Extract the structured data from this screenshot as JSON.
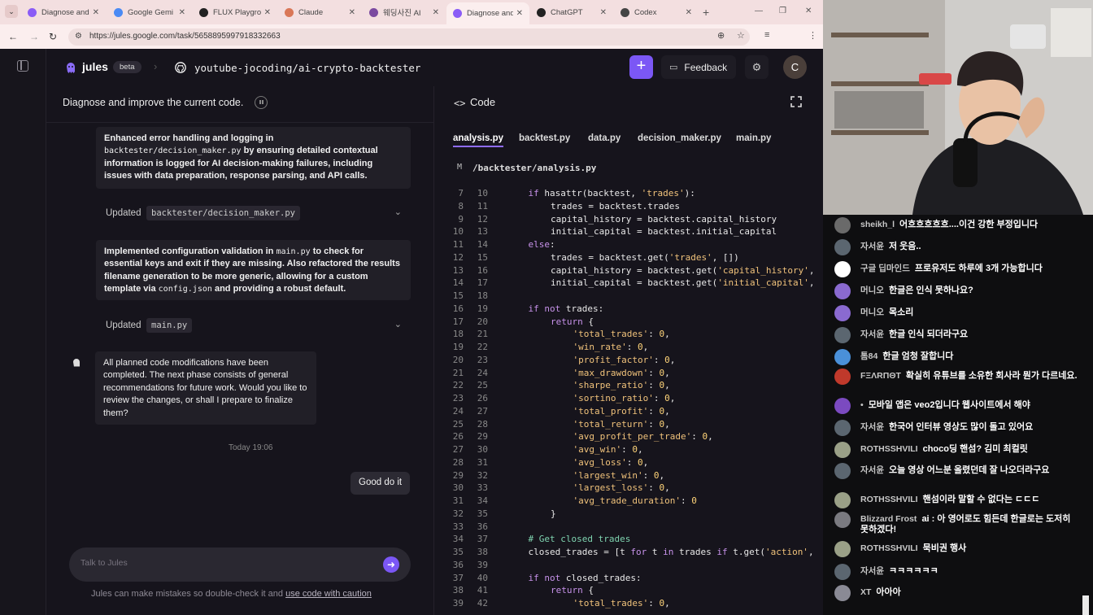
{
  "browser": {
    "tabs": [
      {
        "title": "Diagnose and",
        "color": "#8a5cf6",
        "active": false
      },
      {
        "title": "Google Gemi",
        "color": "#4a8af4",
        "active": false
      },
      {
        "title": "FLUX Playgro",
        "color": "#222222",
        "active": false
      },
      {
        "title": "Claude",
        "color": "#d97757",
        "active": false
      },
      {
        "title": "웨딩사진 AI",
        "color": "#7b4aa0",
        "active": false
      },
      {
        "title": "Diagnose and",
        "color": "#8a5cf6",
        "active": true
      },
      {
        "title": "ChatGPT",
        "color": "#222222",
        "active": false
      },
      {
        "title": "Codex",
        "color": "#444444",
        "active": false
      }
    ],
    "url": "https://jules.google.com/task/5658895997918332663",
    "profile_initial": "C"
  },
  "app": {
    "brand": "jules",
    "beta": "beta",
    "repo": "youtube-jocoding/ai-crypto-backtester",
    "plus": "+",
    "feedback": "Feedback",
    "avatar": "C",
    "accent": "#7b57f5"
  },
  "chat": {
    "task_title": "Diagnose and improve the current code.",
    "msg1": {
      "part1": "Enhanced error handling and logging in",
      "code1": "backtester/decision_maker.py",
      "part2": "by ensuring detailed contextual information is logged for AI decision-making failures, including issues with data preparation, response parsing, and API calls."
    },
    "updated1": {
      "label": "Updated",
      "file": "backtester/decision_maker.py"
    },
    "msg2": {
      "part1": "Implemented configuration validation in",
      "code1": "main.py",
      "part2": "to check for essential keys and exit if they are missing. Also refactored the results filename generation to be more generic, allowing for a custom template via",
      "code2": "config.json",
      "part3": "and providing a robust default."
    },
    "updated2": {
      "label": "Updated",
      "file": "main.py"
    },
    "msg3": "All planned code modifications have been completed. The next phase consists of general recommendations for future work. Would you like to review the changes, or shall I prepare to finalize them?",
    "timestamp": "Today 19:06",
    "user_msg": "Good do it",
    "composer_placeholder": "Talk to Jules",
    "disclaimer_text": "Jules can make mistakes so double-check it and",
    "disclaimer_link": "use code with caution"
  },
  "code": {
    "title": "Code",
    "tabs": [
      "analysis.py",
      "backtest.py",
      "data.py",
      "decision_maker.py",
      "main.py"
    ],
    "path_badge": "M",
    "path": "/backtester/analysis.py",
    "lines": [
      {
        "a": "7",
        "b": "10",
        "indent": 1,
        "segs": [
          [
            "kw",
            "if "
          ],
          [
            "",
            "hasattr(backtest, "
          ],
          [
            "str",
            "'trades'"
          ],
          [
            "",
            "):"
          ]
        ]
      },
      {
        "a": "8",
        "b": "11",
        "indent": 2,
        "segs": [
          [
            "",
            "trades = backtest.trades"
          ]
        ]
      },
      {
        "a": "9",
        "b": "12",
        "indent": 2,
        "segs": [
          [
            "",
            "capital_history = backtest.capital_history"
          ]
        ]
      },
      {
        "a": "10",
        "b": "13",
        "indent": 2,
        "segs": [
          [
            "",
            "initial_capital = backtest.initial_capital"
          ]
        ]
      },
      {
        "a": "11",
        "b": "14",
        "indent": 1,
        "segs": [
          [
            "kw",
            "else"
          ],
          [
            "",
            ":"
          ]
        ]
      },
      {
        "a": "12",
        "b": "15",
        "indent": 2,
        "segs": [
          [
            "",
            "trades = backtest.get("
          ],
          [
            "str",
            "'trades'"
          ],
          [
            "",
            ", [])"
          ]
        ]
      },
      {
        "a": "13",
        "b": "16",
        "indent": 2,
        "segs": [
          [
            "",
            "capital_history = backtest.get("
          ],
          [
            "str",
            "'capital_history'"
          ],
          [
            "",
            ","
          ]
        ]
      },
      {
        "a": "14",
        "b": "17",
        "indent": 2,
        "segs": [
          [
            "",
            "initial_capital = backtest.get("
          ],
          [
            "str",
            "'initial_capital'"
          ],
          [
            "",
            ","
          ]
        ]
      },
      {
        "a": "15",
        "b": "18",
        "indent": 0,
        "segs": []
      },
      {
        "a": "16",
        "b": "19",
        "indent": 1,
        "segs": [
          [
            "kw",
            "if not "
          ],
          [
            "",
            "trades:"
          ]
        ]
      },
      {
        "a": "17",
        "b": "20",
        "indent": 2,
        "segs": [
          [
            "kw",
            "return "
          ],
          [
            "",
            "{"
          ]
        ]
      },
      {
        "a": "18",
        "b": "21",
        "indent": 3,
        "segs": [
          [
            "str",
            "'total_trades'"
          ],
          [
            "",
            ": "
          ],
          [
            "num",
            "0"
          ],
          [
            "",
            ","
          ]
        ]
      },
      {
        "a": "19",
        "b": "22",
        "indent": 3,
        "segs": [
          [
            "str",
            "'win_rate'"
          ],
          [
            "",
            ": "
          ],
          [
            "num",
            "0"
          ],
          [
            "",
            ","
          ]
        ]
      },
      {
        "a": "20",
        "b": "23",
        "indent": 3,
        "segs": [
          [
            "str",
            "'profit_factor'"
          ],
          [
            "",
            ": "
          ],
          [
            "num",
            "0"
          ],
          [
            "",
            ","
          ]
        ]
      },
      {
        "a": "21",
        "b": "24",
        "indent": 3,
        "segs": [
          [
            "str",
            "'max_drawdown'"
          ],
          [
            "",
            ": "
          ],
          [
            "num",
            "0"
          ],
          [
            "",
            ","
          ]
        ]
      },
      {
        "a": "22",
        "b": "25",
        "indent": 3,
        "segs": [
          [
            "str",
            "'sharpe_ratio'"
          ],
          [
            "",
            ": "
          ],
          [
            "num",
            "0"
          ],
          [
            "",
            ","
          ]
        ]
      },
      {
        "a": "23",
        "b": "26",
        "indent": 3,
        "segs": [
          [
            "str",
            "'sortino_ratio'"
          ],
          [
            "",
            ": "
          ],
          [
            "num",
            "0"
          ],
          [
            "",
            ","
          ]
        ]
      },
      {
        "a": "24",
        "b": "27",
        "indent": 3,
        "segs": [
          [
            "str",
            "'total_profit'"
          ],
          [
            "",
            ": "
          ],
          [
            "num",
            "0"
          ],
          [
            "",
            ","
          ]
        ]
      },
      {
        "a": "25",
        "b": "28",
        "indent": 3,
        "segs": [
          [
            "str",
            "'total_return'"
          ],
          [
            "",
            ": "
          ],
          [
            "num",
            "0"
          ],
          [
            "",
            ","
          ]
        ]
      },
      {
        "a": "26",
        "b": "29",
        "indent": 3,
        "segs": [
          [
            "str",
            "'avg_profit_per_trade'"
          ],
          [
            "",
            ": "
          ],
          [
            "num",
            "0"
          ],
          [
            "",
            ","
          ]
        ]
      },
      {
        "a": "27",
        "b": "30",
        "indent": 3,
        "segs": [
          [
            "str",
            "'avg_win'"
          ],
          [
            "",
            ": "
          ],
          [
            "num",
            "0"
          ],
          [
            "",
            ","
          ]
        ]
      },
      {
        "a": "28",
        "b": "31",
        "indent": 3,
        "segs": [
          [
            "str",
            "'avg_loss'"
          ],
          [
            "",
            ": "
          ],
          [
            "num",
            "0"
          ],
          [
            "",
            ","
          ]
        ]
      },
      {
        "a": "29",
        "b": "32",
        "indent": 3,
        "segs": [
          [
            "str",
            "'largest_win'"
          ],
          [
            "",
            ": "
          ],
          [
            "num",
            "0"
          ],
          [
            "",
            ","
          ]
        ]
      },
      {
        "a": "30",
        "b": "33",
        "indent": 3,
        "segs": [
          [
            "str",
            "'largest_loss'"
          ],
          [
            "",
            ": "
          ],
          [
            "num",
            "0"
          ],
          [
            "",
            ","
          ]
        ]
      },
      {
        "a": "31",
        "b": "34",
        "indent": 3,
        "segs": [
          [
            "str",
            "'avg_trade_duration'"
          ],
          [
            "",
            ": "
          ],
          [
            "num",
            "0"
          ]
        ]
      },
      {
        "a": "32",
        "b": "35",
        "indent": 2,
        "segs": [
          [
            "",
            "}"
          ]
        ]
      },
      {
        "a": "33",
        "b": "36",
        "indent": 0,
        "segs": []
      },
      {
        "a": "34",
        "b": "37",
        "indent": 1,
        "segs": [
          [
            "cm",
            "# Get closed trades"
          ]
        ]
      },
      {
        "a": "35",
        "b": "38",
        "indent": 1,
        "segs": [
          [
            "",
            "closed_trades = [t "
          ],
          [
            "kw",
            "for "
          ],
          [
            "",
            "t "
          ],
          [
            "kw",
            "in "
          ],
          [
            "",
            "trades "
          ],
          [
            "kw",
            "if "
          ],
          [
            "",
            "t.get("
          ],
          [
            "str",
            "'action'"
          ],
          [
            "",
            ","
          ]
        ]
      },
      {
        "a": "36",
        "b": "39",
        "indent": 0,
        "segs": []
      },
      {
        "a": "37",
        "b": "40",
        "indent": 1,
        "segs": [
          [
            "kw",
            "if not "
          ],
          [
            "",
            "closed_trades:"
          ]
        ]
      },
      {
        "a": "38",
        "b": "41",
        "indent": 2,
        "segs": [
          [
            "kw",
            "return "
          ],
          [
            "",
            "{"
          ]
        ]
      },
      {
        "a": "39",
        "b": "42",
        "indent": 3,
        "segs": [
          [
            "str",
            "'total_trades'"
          ],
          [
            "",
            ": "
          ],
          [
            "num",
            "0"
          ],
          [
            "",
            ","
          ]
        ]
      }
    ]
  },
  "stream_chat": [
    {
      "user": "sheikh_l",
      "text": "어흐흐흐흐흐....이건 강한 부정입니다",
      "color": "#6a6a6a"
    },
    {
      "user": "자서윤",
      "text": "저 웃음..",
      "color": "#5b6670"
    },
    {
      "user": "구글 딥마인드",
      "text": "프로유저도 하루에 3개 가능합니다",
      "color": "#ffffff"
    },
    {
      "user": "머니오",
      "text": "한글은 인식 못하나요?",
      "color": "#8a6ad0"
    },
    {
      "user": "머니오",
      "text": "목소리",
      "color": "#8a6ad0"
    },
    {
      "user": "자서윤",
      "text": "한글 인식 되더라구요",
      "color": "#5b6670"
    },
    {
      "user": "톰84",
      "text": "한글 엄청 잘합니다",
      "color": "#4a90d9"
    },
    {
      "user": "FΞΛRΠΘT",
      "text": "확실히 유튜브를 소유한 회사라 뭔가 다르네요.",
      "color": "#c0392b"
    },
    {
      "user": "•",
      "text": "모바일 앱은 veo2입니다 웹사이트에서 해야",
      "color": "#7b4ac0"
    },
    {
      "user": "자서윤",
      "text": "한국어 인터뷰 영상도 많이 돌고 있어요",
      "color": "#5b6670"
    },
    {
      "user": "ROTHSSHVILI",
      "text": "choco딩 핸섬? 김미 최컬릿",
      "color": "#9aa087"
    },
    {
      "user": "자서윤",
      "text": "오늘 영상 어느분 올렸던데 잘 나오더라구요",
      "color": "#5b6670"
    },
    {
      "user": "ROTHSSHVILI",
      "text": "핸섬이라 말할 수 없다는 ㄷㄷㄷ",
      "color": "#9aa087"
    },
    {
      "user": "Blizzard Frost",
      "text": "ai : 아 영어로도 힘든데 한글로는 도저히 못하겠다!",
      "color": "#7a7a80"
    },
    {
      "user": "ROTHSSHVILI",
      "text": "묵비권 행사",
      "color": "#9aa087"
    },
    {
      "user": "자서윤",
      "text": "ㅋㅋㅋㅋㅋㅋ",
      "color": "#5b6670"
    },
    {
      "user": "XT",
      "text": "아아아",
      "color": "#8a8a95"
    }
  ]
}
